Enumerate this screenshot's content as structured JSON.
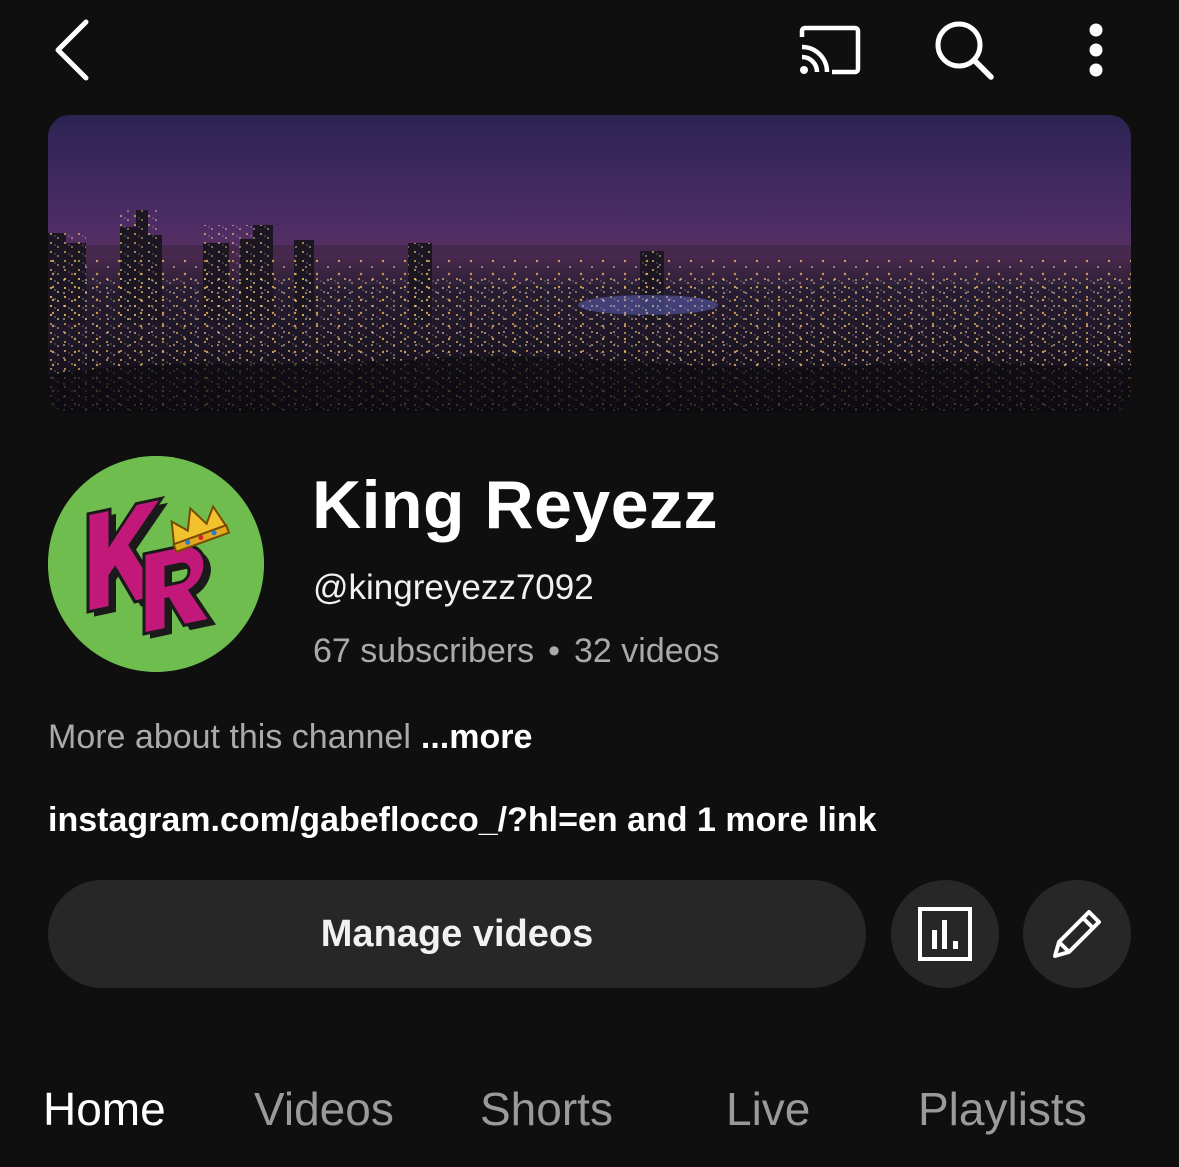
{
  "topbar": {
    "back_icon": "chevron-left-icon",
    "cast_icon": "cast-icon",
    "search_icon": "search-icon",
    "more_icon": "more-vertical-icon"
  },
  "banner": {
    "description_icon": "channel-banner-image"
  },
  "avatar": {
    "letters": "KR"
  },
  "channel": {
    "name": "King Reyezz",
    "handle": "@kingreyezz7092",
    "subscribers": "67 subscribers",
    "separator": "•",
    "videos": "32 videos"
  },
  "about": {
    "text": "More about this channel",
    "more_label": "...more"
  },
  "links": {
    "text": "instagram.com/gabeflocco_/?hl=en and 1 more link"
  },
  "actions": {
    "manage_label": "Manage videos",
    "analytics_icon": "analytics-icon",
    "edit_icon": "pencil-icon"
  },
  "tabs": [
    {
      "label": "Home",
      "active": true
    },
    {
      "label": "Videos",
      "active": false
    },
    {
      "label": "Shorts",
      "active": false
    },
    {
      "label": "Live",
      "active": false
    },
    {
      "label": "Playlists",
      "active": false
    }
  ],
  "colors": {
    "background": "#0f0f0f",
    "button_bg": "#272727",
    "secondary_text": "#aaaaaa",
    "avatar_green": "#6fbd4f",
    "avatar_magenta": "#c2187a"
  }
}
